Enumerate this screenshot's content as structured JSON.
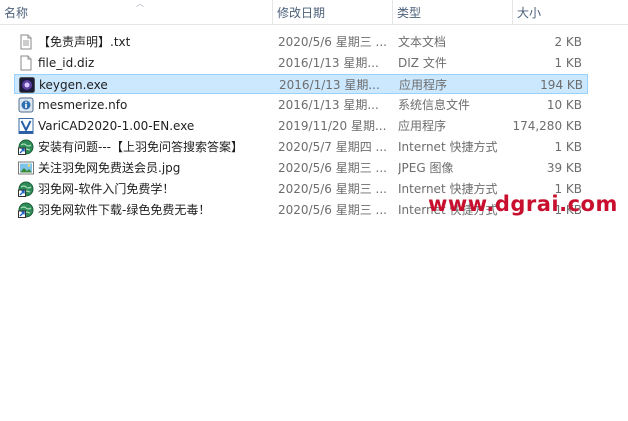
{
  "columns": {
    "name": "名称",
    "date": "修改日期",
    "type": "类型",
    "size": "大小"
  },
  "files": [
    {
      "name": "【免责声明】.txt",
      "date": "2020/5/6 星期三 ...",
      "type": "文本文档",
      "size": "2 KB",
      "icon": "text-file-icon"
    },
    {
      "name": "file_id.diz",
      "date": "2016/1/13 星期...",
      "type": "DIZ 文件",
      "size": "1 KB",
      "icon": "blank-file-icon"
    },
    {
      "name": "keygen.exe",
      "date": "2016/1/13 星期...",
      "type": "应用程序",
      "size": "194 KB",
      "icon": "keygen-app-icon",
      "selected": true
    },
    {
      "name": "mesmerize.nfo",
      "date": "2016/1/13 星期...",
      "type": "系统信息文件",
      "size": "10 KB",
      "icon": "system-info-icon"
    },
    {
      "name": "VariCAD2020-1.00-EN.exe",
      "date": "2019/11/20 星期...",
      "type": "应用程序",
      "size": "174,280 KB",
      "icon": "varicad-app-icon"
    },
    {
      "name": "安装有问题---【上羽免问答搜索答案】",
      "date": "2020/5/7 星期四 ...",
      "type": "Internet 快捷方式",
      "size": "1 KB",
      "icon": "internet-shortcut-icon"
    },
    {
      "name": "关注羽免网免费送会员.jpg",
      "date": "2020/5/6 星期三 ...",
      "type": "JPEG 图像",
      "size": "39 KB",
      "icon": "image-file-icon"
    },
    {
      "name": "羽免网-软件入门免费学！",
      "date": "2020/5/6 星期三 ...",
      "type": "Internet 快捷方式",
      "size": "1 KB",
      "icon": "internet-shortcut-icon"
    },
    {
      "name": "羽免网软件下载-绿色免费无毒！",
      "date": "2020/5/6 星期三 ...",
      "type": "Internet 快捷方式",
      "size": "1 KB",
      "icon": "internet-shortcut-icon"
    }
  ],
  "watermark": "www.dgrai.com",
  "colors": {
    "selection_bg": "#cce8ff",
    "selection_border": "#99d1ff",
    "header_text": "#4c607a",
    "watermark": "#c8102e"
  }
}
